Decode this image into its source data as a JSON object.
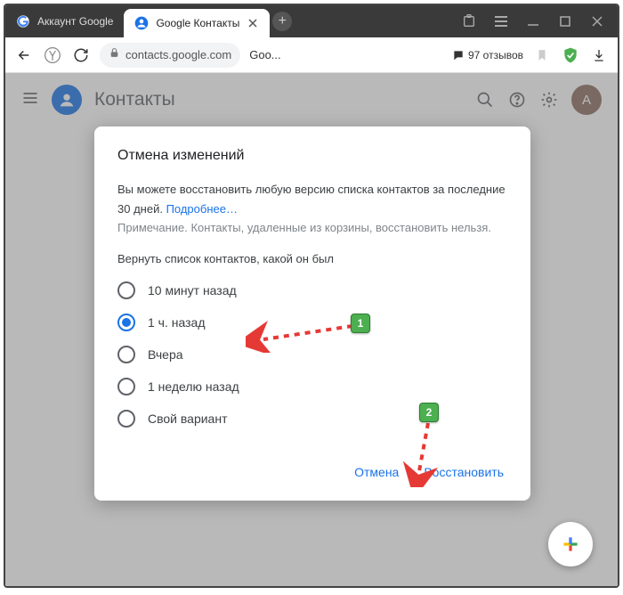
{
  "titlebar": {
    "tabs": [
      {
        "label": "Аккаунт Google"
      },
      {
        "label": "Google Контакты"
      }
    ]
  },
  "addressbar": {
    "url": "contacts.google.com",
    "extra": "Goo...",
    "reviews": "97 отзывов"
  },
  "header": {
    "title": "Контакты",
    "avatar_letter": "A"
  },
  "dialog": {
    "title": "Отмена изменений",
    "desc": "Вы можете восстановить любую версию списка контактов за последние 30 дней. ",
    "link": "Подробнее…",
    "note": "Примечание. Контакты, удаленные из корзины, восстановить нельзя.",
    "prompt": "Вернуть список контактов, какой он был",
    "options": [
      "10 минут назад",
      "1 ч. назад",
      "Вчера",
      "1 неделю назад",
      "Свой вариант"
    ],
    "cancel": "Отмена",
    "confirm": "Восстановить"
  },
  "annotations": {
    "badge1": "1",
    "badge2": "2"
  }
}
